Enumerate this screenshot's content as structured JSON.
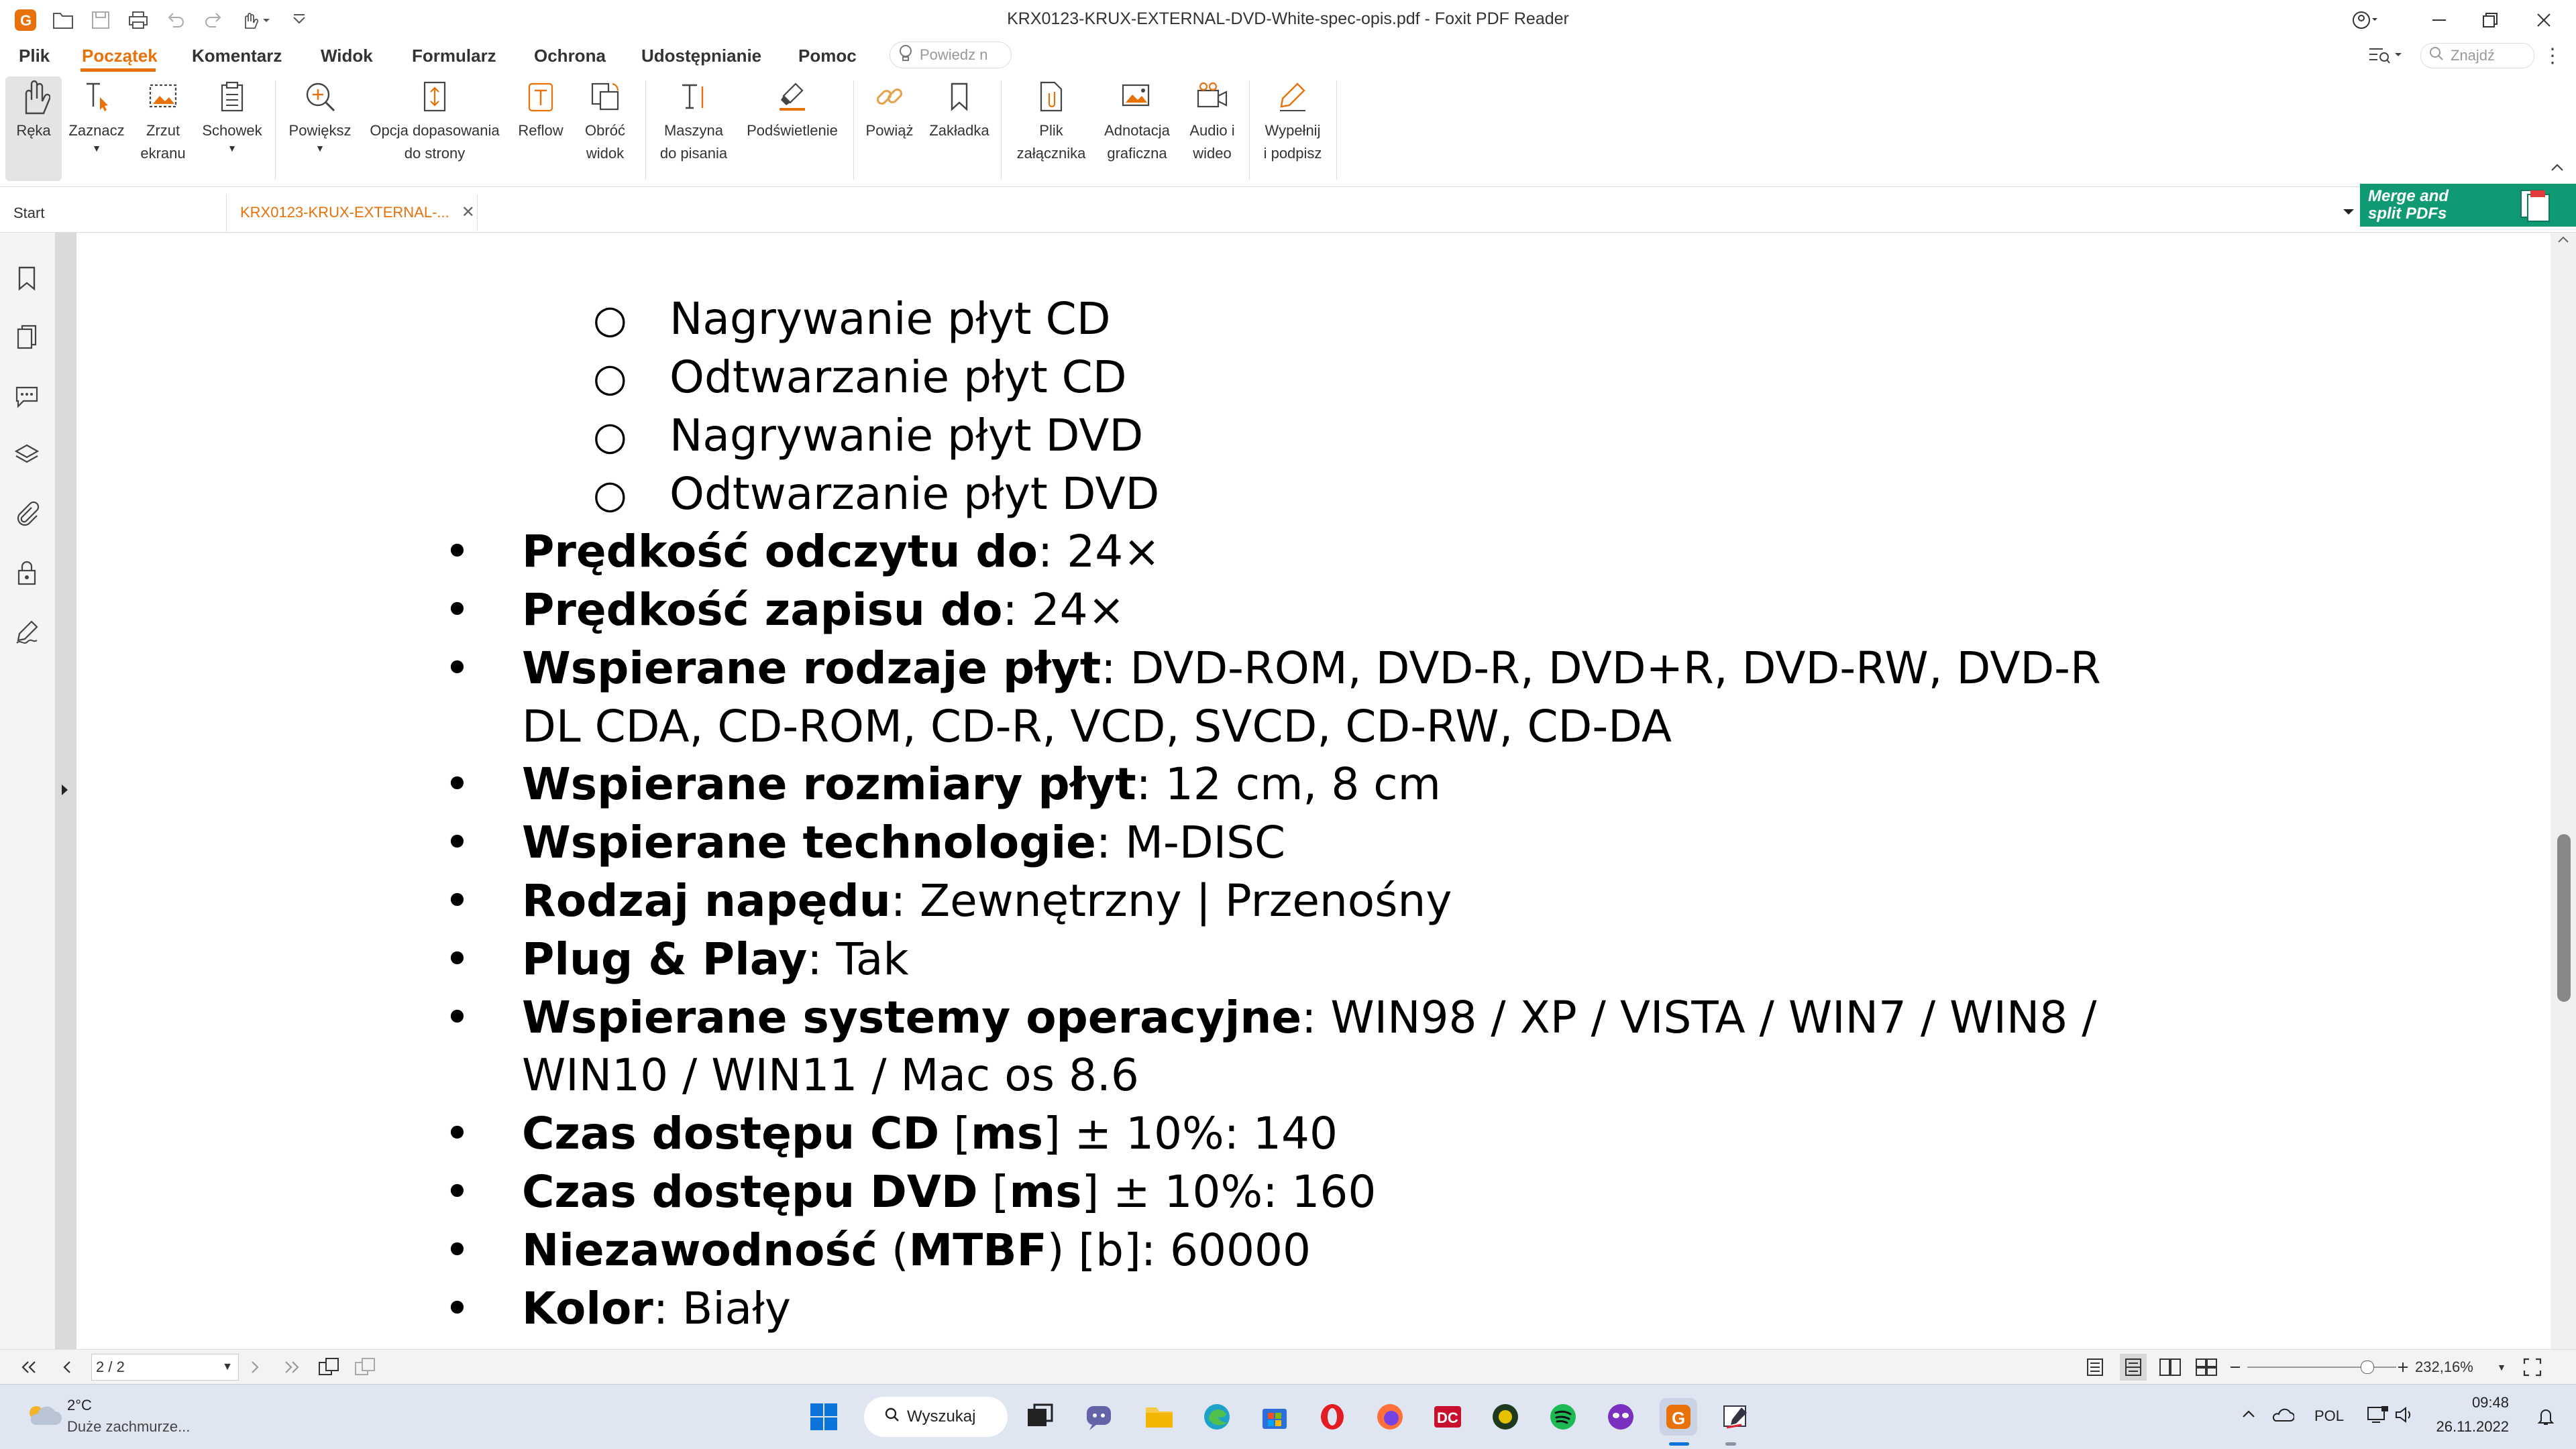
{
  "window": {
    "title": "KRX0123-KRUX-EXTERNAL-DVD-White-spec-opis.pdf - Foxit PDF Reader"
  },
  "menu": {
    "tabs": [
      "Plik",
      "Początek",
      "Komentarz",
      "Widok",
      "Formularz",
      "Ochrona",
      "Udostępnianie",
      "Pomoc"
    ],
    "active": "Początek",
    "tell_me_placeholder": "Powiedz n",
    "find_placeholder": "Znajdź"
  },
  "ribbon": {
    "hand": "Ręka",
    "select": "Zaznacz",
    "snapshot_1": "Zrzut",
    "snapshot_2": "ekranu",
    "clipboard": "Schowek",
    "zoom": "Powiększ",
    "fit_1": "Opcja dopasowania",
    "fit_2": "do strony",
    "reflow": "Reflow",
    "rotate_1": "Obróć",
    "rotate_2": "widok",
    "typewriter_1": "Maszyna",
    "typewriter_2": "do pisania",
    "highlight": "Podświetlenie",
    "link": "Powiąż",
    "bookmark": "Zakładka",
    "attach_1": "Plik",
    "attach_2": "załącznika",
    "image_1": "Adnotacja",
    "image_2": "graficzna",
    "media_1": "Audio i",
    "media_2": "wideo",
    "sign_1": "Wypełnij",
    "sign_2": "i podpisz"
  },
  "doc_tabs": {
    "start": "Start",
    "document": "KRX0123-KRUX-EXTERNAL-...",
    "promo_1": "Merge and",
    "promo_2": "split PDFs"
  },
  "content": {
    "sub_items": [
      "Nagrywanie płyt CD",
      "Odtwarzanie płyt CD",
      "Nagrywanie płyt DVD",
      "Odtwarzanie płyt DVD"
    ],
    "items": [
      {
        "label": "Prędkość odczytu do",
        "value": ": 24×"
      },
      {
        "label": "Prędkość zapisu do",
        "value": ": 24×"
      },
      {
        "label": "Wspierane rodzaje płyt",
        "value": ": DVD-ROM, DVD-R, DVD+R, DVD-RW, DVD-R",
        "cont": "DL CDA, CD-ROM, CD-R, VCD, SVCD, CD-RW, CD-DA"
      },
      {
        "label": "Wspierane rozmiary płyt",
        "value": ": 12 cm, 8 cm"
      },
      {
        "label": "Wspierane technologie",
        "value": ": M-DISC"
      },
      {
        "label": "Rodzaj napędu",
        "value": ": Zewnętrzny | Przenośny"
      },
      {
        "label": "Plug & Play",
        "value": ": Tak"
      },
      {
        "label": "Wspierane systemy operacyjne",
        "value": ": WIN98 / XP / VISTA / WIN7 / WIN8 /",
        "cont": "WIN10 / WIN11 / Mac os 8.6"
      }
    ],
    "cd_access": {
      "a": "Czas dostępu CD",
      "b": " [",
      "c": "ms",
      "d": "] ± 10%: 140"
    },
    "dvd_access": {
      "a": "Czas dostępu DVD",
      "b": " [",
      "c": "ms",
      "d": "] ± 10%: 160"
    },
    "mtbf": {
      "a": "Niezawodność",
      "b": " (",
      "c": "MTBF",
      "d": ") [b]: 60000"
    },
    "color": {
      "label": "Kolor",
      "value": ": Biały"
    }
  },
  "status": {
    "page": "2 / 2",
    "zoom": "232,16%",
    "zoom_fraction": 0.8
  },
  "taskbar": {
    "temp": "2°C",
    "weather": "Duże zachmurze...",
    "search": "Wyszukaj",
    "lang": "POL",
    "time": "09:48",
    "date": "26.11.2022"
  },
  "colors": {
    "accent": "#e8710a",
    "promo": "#109a73"
  }
}
